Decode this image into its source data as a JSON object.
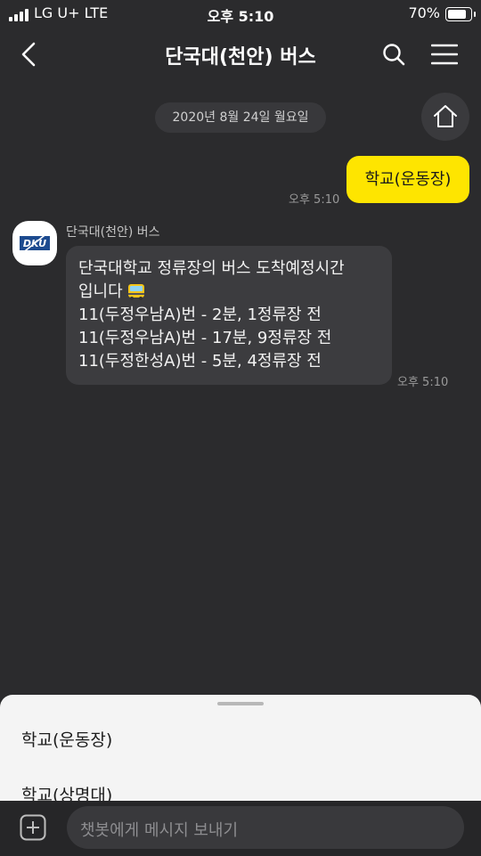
{
  "status_bar": {
    "carrier": "LG U+  LTE",
    "time": "오후 5:10",
    "battery": "70%"
  },
  "header": {
    "title": "단국대(천안) 버스"
  },
  "chat": {
    "date": "2020년 8월 24일 월요일",
    "outgoing": {
      "text": "학교(운동장)",
      "time": "오후 5:10"
    },
    "incoming": {
      "sender": "단국대(천안) 버스",
      "lines": [
        "단국대학교 정류장의 버스 도착예정시간",
        "입니다",
        "11(두정우남A)번 - 2분, 1정류장 전",
        "11(두정우남A)번 - 17분, 9정류장 전",
        "11(두정한성A)번 - 5분, 4정류장 전"
      ],
      "time": "오후 5:10",
      "avatar_text": "DKU"
    }
  },
  "quick_replies": [
    "학교(운동장)",
    "학교(상명대)"
  ],
  "input": {
    "placeholder": "챗봇에게 메시지 보내기"
  },
  "colors": {
    "background": "#2b2b2d",
    "outgoing_bubble": "#fee500",
    "incoming_bubble": "#3c3c3f",
    "sheet": "#f4f4f4"
  },
  "icons": [
    "signal-icon",
    "battery-icon",
    "back-icon",
    "search-icon",
    "menu-icon",
    "home-icon",
    "bus-emoji-icon",
    "plus-icon"
  ]
}
